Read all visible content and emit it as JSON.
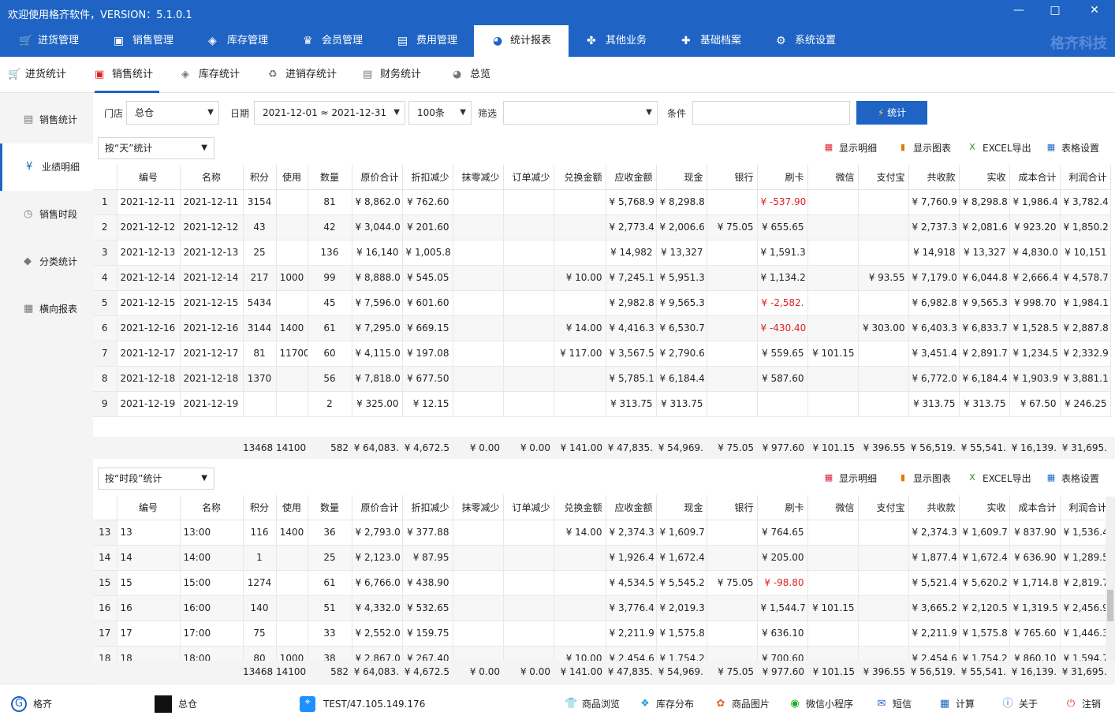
{
  "window": {
    "title": "欢迎使用格齐软件，VERSION：5.1.0.1",
    "min": "—",
    "max": "□",
    "close": "✕"
  },
  "mainnav": {
    "items": [
      {
        "label": "进货管理",
        "icon": "cart-icon"
      },
      {
        "label": "销售管理",
        "icon": "bag-icon"
      },
      {
        "label": "库存管理",
        "icon": "box-icon"
      },
      {
        "label": "会员管理",
        "icon": "crown-icon"
      },
      {
        "label": "费用管理",
        "icon": "wallet-icon"
      },
      {
        "label": "统计报表",
        "icon": "pie-icon"
      },
      {
        "label": "其他业务",
        "icon": "grid-icon"
      },
      {
        "label": "基础档案",
        "icon": "puzzle-icon"
      },
      {
        "label": "系统设置",
        "icon": "gear-icon"
      }
    ],
    "brand": "格齐科技"
  },
  "subnav": {
    "items": [
      "进货统计",
      "销售统计",
      "库存统计",
      "进销存统计",
      "财务统计",
      "总览"
    ]
  },
  "sidebar": {
    "items": [
      "销售统计",
      "业绩明细",
      "销售时段",
      "分类统计",
      "横向报表"
    ]
  },
  "filters": {
    "store_label": "门店",
    "store": "总仓",
    "date_label": "日期",
    "date": "2021-12-01 ≈ 2021-12-31",
    "limit": "100条",
    "filter_label": "筛选",
    "filter": "",
    "cond_label": "条件",
    "cond": "",
    "stat_btn": "统计"
  },
  "top": {
    "group": "按“天”统计",
    "toolbar": [
      "显示明细",
      "显示图表",
      "EXCEL导出",
      "表格设置"
    ],
    "headers": [
      "编号",
      "名称",
      "积分",
      "使用",
      "数量",
      "原价合计",
      "折扣减少",
      "抹零减少",
      "订单减少",
      "兑换金额",
      "应收金额",
      "现金",
      "银行",
      "刷卡",
      "微信",
      "支付宝",
      "共收款",
      "实收",
      "成本合计",
      "利润合计"
    ],
    "rows": [
      [
        "1",
        "2021-12-11",
        "2021-12-11",
        "3154",
        "",
        "81",
        "¥ 8,862.0",
        "¥ 762.60",
        "",
        "",
        "",
        "¥ 5,768.9",
        "¥ 8,298.8",
        "",
        "¥ -537.90",
        "",
        "",
        "¥ 7,760.9",
        "¥ 8,298.8",
        "¥ 1,986.4",
        "¥ 3,782.4"
      ],
      [
        "2",
        "2021-12-12",
        "2021-12-12",
        "43",
        "",
        "42",
        "¥ 3,044.0",
        "¥ 201.60",
        "",
        "",
        "",
        "¥ 2,773.4",
        "¥ 2,006.6",
        "¥ 75.05",
        "¥ 655.65",
        "",
        "",
        "¥ 2,737.3",
        "¥ 2,081.6",
        "¥ 923.20",
        "¥ 1,850.2"
      ],
      [
        "3",
        "2021-12-13",
        "2021-12-13",
        "25",
        "",
        "136",
        "¥ 16,140",
        "¥ 1,005.8",
        "",
        "",
        "",
        "¥ 14,982",
        "¥ 13,327",
        "",
        "¥ 1,591.3",
        "",
        "",
        "¥ 14,918",
        "¥ 13,327",
        "¥ 4,830.0",
        "¥ 10,151"
      ],
      [
        "4",
        "2021-12-14",
        "2021-12-14",
        "217",
        "1000",
        "99",
        "¥ 8,888.0",
        "¥ 545.05",
        "",
        "",
        "¥ 10.00",
        "¥ 7,245.1",
        "¥ 5,951.3",
        "",
        "¥ 1,134.2",
        "",
        "¥ 93.55",
        "¥ 7,179.0",
        "¥ 6,044.8",
        "¥ 2,666.4",
        "¥ 4,578.7"
      ],
      [
        "5",
        "2021-12-15",
        "2021-12-15",
        "5434",
        "",
        "45",
        "¥ 7,596.0",
        "¥ 601.60",
        "",
        "",
        "",
        "¥ 2,982.8",
        "¥ 9,565.3",
        "",
        "¥ -2,582.",
        "",
        "",
        "¥ 6,982.8",
        "¥ 9,565.3",
        "¥ 998.70",
        "¥ 1,984.1"
      ],
      [
        "6",
        "2021-12-16",
        "2021-12-16",
        "3144",
        "1400",
        "61",
        "¥ 7,295.0",
        "¥ 669.15",
        "",
        "",
        "¥ 14.00",
        "¥ 4,416.3",
        "¥ 6,530.7",
        "",
        "¥ -430.40",
        "",
        "¥ 303.00",
        "¥ 6,403.3",
        "¥ 6,833.7",
        "¥ 1,528.5",
        "¥ 2,887.8"
      ],
      [
        "7",
        "2021-12-17",
        "2021-12-17",
        "81",
        "11700",
        "60",
        "¥ 4,115.0",
        "¥ 197.08",
        "",
        "",
        "¥ 117.00",
        "¥ 3,567.5",
        "¥ 2,790.6",
        "",
        "¥ 559.65",
        "¥ 101.15",
        "",
        "¥ 3,451.4",
        "¥ 2,891.7",
        "¥ 1,234.5",
        "¥ 2,332.9"
      ],
      [
        "8",
        "2021-12-18",
        "2021-12-18",
        "1370",
        "",
        "56",
        "¥ 7,818.0",
        "¥ 677.50",
        "",
        "",
        "",
        "¥ 5,785.1",
        "¥ 6,184.4",
        "",
        "¥ 587.60",
        "",
        "",
        "¥ 6,772.0",
        "¥ 6,184.4",
        "¥ 1,903.9",
        "¥ 3,881.1"
      ],
      [
        "9",
        "2021-12-19",
        "2021-12-19",
        "",
        "",
        "2",
        "¥ 325.00",
        "¥ 12.15",
        "",
        "",
        "",
        "¥ 313.75",
        "¥ 313.75",
        "",
        "",
        "",
        "",
        "¥ 313.75",
        "¥ 313.75",
        "¥ 67.50",
        "¥ 246.25"
      ]
    ],
    "totals": [
      "13468",
      "14100",
      "582",
      "¥ 64,083.",
      "¥ 4,672.5",
      "¥ 0.00",
      "¥ 0.00",
      "¥ 141.00",
      "¥ 47,835.",
      "¥ 54,969.",
      "¥ 75.05",
      "¥ 977.60",
      "¥ 101.15",
      "¥ 396.55",
      "¥ 56,519.",
      "¥ 55,541.",
      "¥ 16,139.",
      "¥ 31,695."
    ]
  },
  "bottom": {
    "group": "按“时段”统计",
    "toolbar": [
      "显示明细",
      "显示图表",
      "EXCEL导出",
      "表格设置"
    ],
    "rows": [
      [
        "13",
        "13",
        "13:00",
        "116",
        "1400",
        "36",
        "¥ 2,793.0",
        "¥ 377.88",
        "",
        "",
        "¥ 14.00",
        "¥ 2,374.3",
        "¥ 1,609.7",
        "",
        "¥ 764.65",
        "",
        "",
        "¥ 2,374.3",
        "¥ 1,609.7",
        "¥ 837.90",
        "¥ 1,536.4"
      ],
      [
        "14",
        "14",
        "14:00",
        "1",
        "",
        "25",
        "¥ 2,123.0",
        "¥ 87.95",
        "",
        "",
        "",
        "¥ 1,926.4",
        "¥ 1,672.4",
        "",
        "¥ 205.00",
        "",
        "",
        "¥ 1,877.4",
        "¥ 1,672.4",
        "¥ 636.90",
        "¥ 1,289.5"
      ],
      [
        "15",
        "15",
        "15:00",
        "1274",
        "",
        "61",
        "¥ 6,766.0",
        "¥ 438.90",
        "",
        "",
        "",
        "¥ 4,534.5",
        "¥ 5,545.2",
        "¥ 75.05",
        "¥ -98.80",
        "",
        "",
        "¥ 5,521.4",
        "¥ 5,620.2",
        "¥ 1,714.8",
        "¥ 2,819.7"
      ],
      [
        "16",
        "16",
        "16:00",
        "140",
        "",
        "51",
        "¥ 4,332.0",
        "¥ 532.65",
        "",
        "",
        "",
        "¥ 3,776.4",
        "¥ 2,019.3",
        "",
        "¥ 1,544.7",
        "¥ 101.15",
        "",
        "¥ 3,665.2",
        "¥ 2,120.5",
        "¥ 1,319.5",
        "¥ 2,456.9"
      ],
      [
        "17",
        "17",
        "17:00",
        "75",
        "",
        "33",
        "¥ 2,552.0",
        "¥ 159.75",
        "",
        "",
        "",
        "¥ 2,211.9",
        "¥ 1,575.8",
        "",
        "¥ 636.10",
        "",
        "",
        "¥ 2,211.9",
        "¥ 1,575.8",
        "¥ 765.60",
        "¥ 1,446.3"
      ],
      [
        "18",
        "18",
        "18:00",
        "80",
        "1000",
        "38",
        "¥ 2,867.0",
        "¥ 267.40",
        "",
        "",
        "¥ 10.00",
        "¥ 2,454.6",
        "¥ 1,754.2",
        "",
        "¥ 700.60",
        "",
        "",
        "¥ 2,454.6",
        "¥ 1,754.2",
        "¥ 860.10",
        "¥ 1,594.7"
      ]
    ],
    "totals": [
      "13468",
      "14100",
      "582",
      "¥ 64,083.",
      "¥ 4,672.5",
      "¥ 0.00",
      "¥ 0.00",
      "¥ 141.00",
      "¥ 47,835.",
      "¥ 54,969.",
      "¥ 75.05",
      "¥ 977.60",
      "¥ 101.15",
      "¥ 396.55",
      "¥ 56,519.",
      "¥ 55,541.",
      "¥ 16,139.",
      "¥ 31,695."
    ]
  },
  "status": {
    "user": "格齐",
    "store": "总仓",
    "server": "TEST/47.105.149.176",
    "links": [
      "商品浏览",
      "库存分布",
      "商品图片",
      "微信小程序",
      "短信",
      "计算",
      "关于",
      "注销"
    ]
  }
}
